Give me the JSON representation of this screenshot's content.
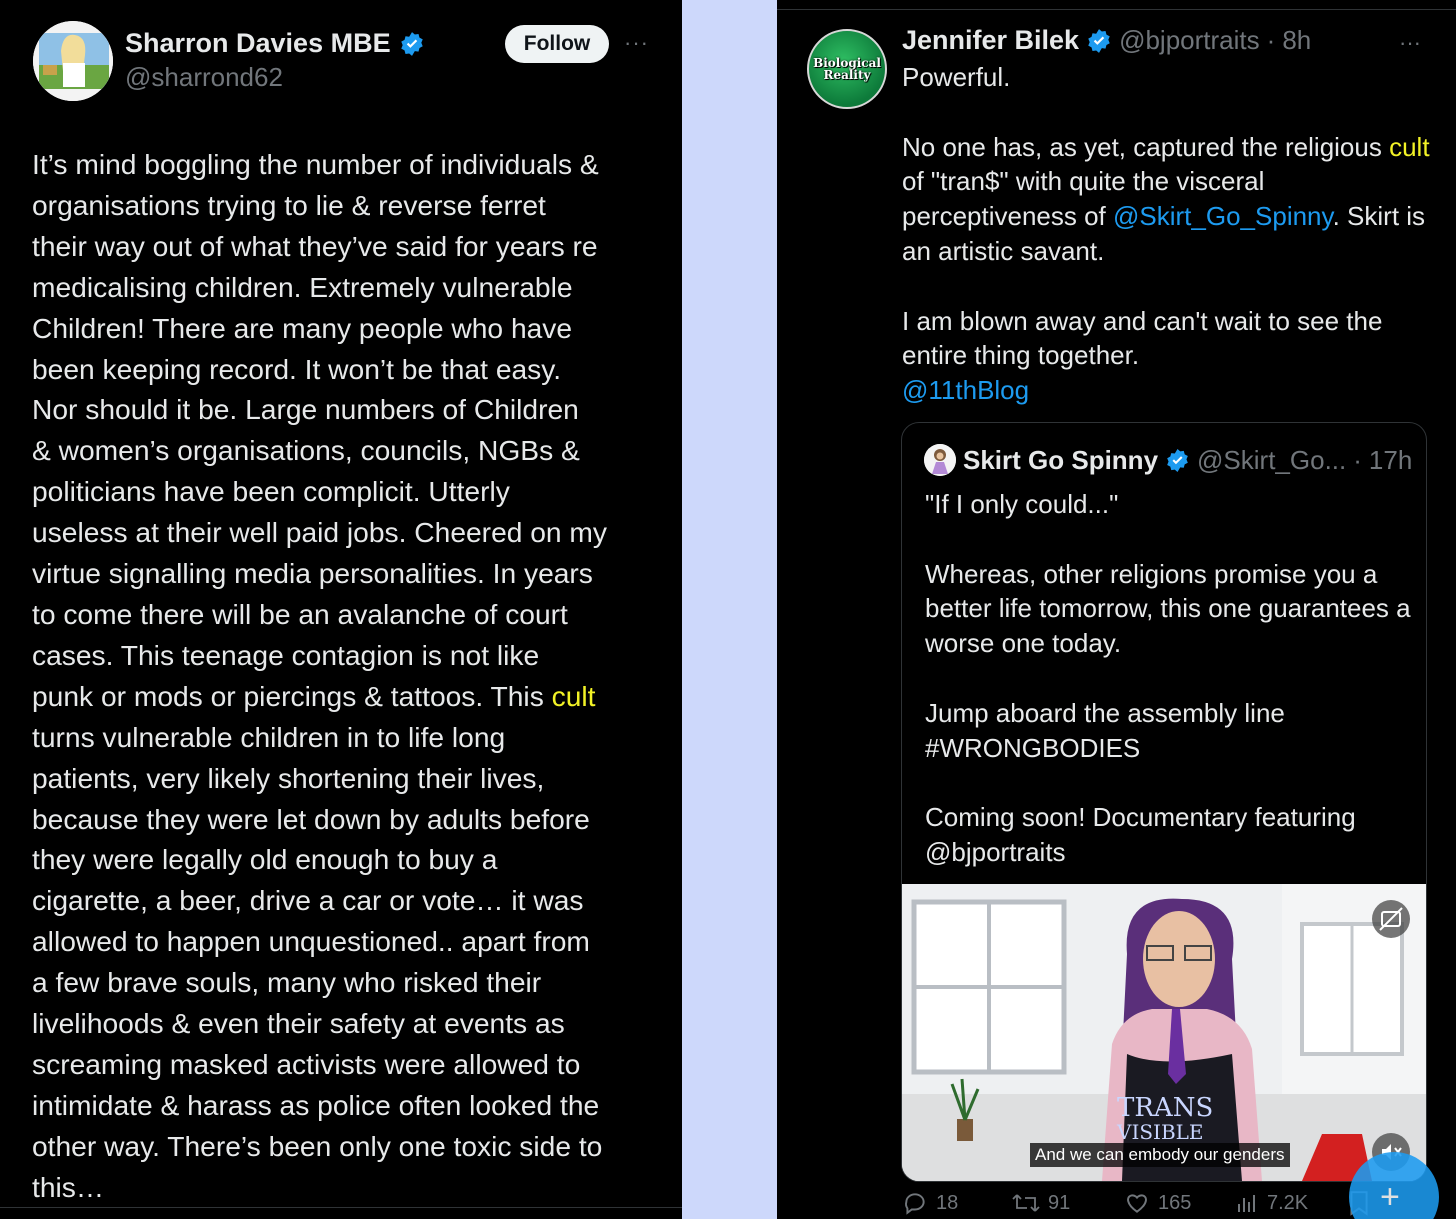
{
  "left_tweet": {
    "author_name": "Sharron Davies MBE",
    "handle": "@sharrond62",
    "follow_label": "Follow",
    "more_label": "···",
    "body_before": "It’s mind boggling the number of individuals &\norganisations trying to lie & reverse ferret\ntheir way out of what they’ve said for years re\nmedicalising children. Extremely vulnerable\nChildren! There are many people who have\nbeen keeping record. It won’t be that easy.\nNor should it be. Large numbers of Children\n& women’s organisations, councils, NGBs &\npoliticians have been complicit.  Utterly\nuseless at their well paid jobs. Cheered on my\nvirtue signalling media personalities. In years\nto come there will be an avalanche of court\ncases. This teenage contagion is not like\npunk or mods or piercings & tattoos. This ",
    "body_highlight": "cult",
    "body_after": "\nturns vulnerable children in to life long\npatients, very likely shortening their lives,\nbecause they were let down by adults before\nthey were legally old enough to buy a\ncigarette, a beer, drive a car or vote… it was\nallowed to happen unquestioned.. apart from\na few brave souls, many who risked their\nlivelihoods & even their safety at events as\nscreaming masked activists were allowed to\nintimidate & harass as police often looked the\nother way. There’s been only one toxic side to\nthis…"
  },
  "right_tweet": {
    "author_name": "Jennifer Bilek",
    "handle": "@bjportraits",
    "separator": "·",
    "time": "8h",
    "more_label": "···",
    "avatar_text_line1": "Biological",
    "avatar_text_line2": "Reality",
    "p1": "Powerful.",
    "p2_a": "No one has, as yet, captured the religious ",
    "p2_highlight": "cult",
    "p2_b": " of \"tran$\" with quite the visceral perceptiveness of ",
    "p2_mention": "@Skirt_Go_Spinny",
    "p2_c": ". Skirt is an artistic savant.",
    "p3": "I am blown away and can't wait to see the entire thing together.",
    "p3_mention": "@11thBlog",
    "quote": {
      "author_name": "Skirt Go Spinny",
      "handle": "@Skirt_Go...",
      "separator": "·",
      "time": "17h",
      "q1": "\"If I only could...\"",
      "q2": "Whereas, other religions promise you a better life tomorrow, this one guarantees a worse one today.",
      "q3a": "Jump aboard the assembly line",
      "q3b": "#WRONGBODIES",
      "q4a": "Coming soon! Documentary featuring",
      "q4b": "@bjportraits",
      "video_caption": "And we can embody our genders",
      "shirt_text_1": "TRANS",
      "shirt_text_2": "VISIBLE"
    },
    "actions": {
      "replies": "18",
      "retweets": "91",
      "likes": "165",
      "views": "7.2K"
    }
  },
  "colors": {
    "highlight": "#f2f226",
    "mention": "#1d9bf0",
    "verified": "#1d9bf0",
    "separator_bg": "#cdd8fb"
  }
}
